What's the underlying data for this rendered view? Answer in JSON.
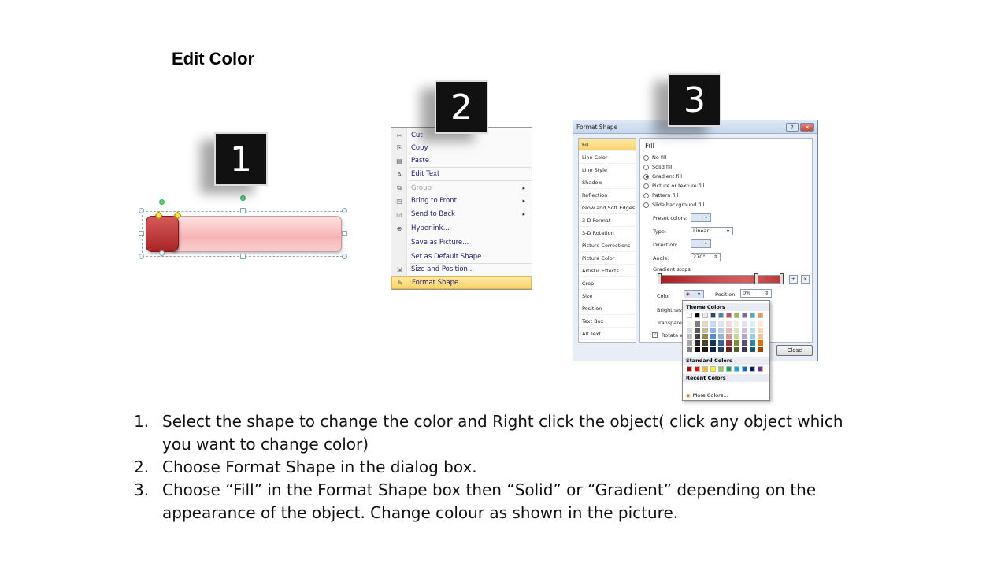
{
  "slide": {
    "title": "Edit Color"
  },
  "steps": [
    "1",
    "2",
    "3"
  ],
  "context_menu": {
    "items": [
      {
        "label": "Cut",
        "icon": "scissors-icon",
        "glyph": "✂",
        "submenu": false,
        "disabled": false,
        "highlight": false
      },
      {
        "label": "Copy",
        "icon": "copy-icon",
        "glyph": "⎘",
        "submenu": false,
        "disabled": false,
        "highlight": false
      },
      {
        "label": "Paste",
        "icon": "paste-icon",
        "glyph": "▤",
        "submenu": false,
        "disabled": false,
        "highlight": false
      },
      {
        "label": "Edit Text",
        "icon": "edit-text-icon",
        "glyph": "A",
        "submenu": false,
        "disabled": false,
        "highlight": false
      },
      {
        "label": "Group",
        "icon": "group-icon",
        "glyph": "⧉",
        "submenu": true,
        "disabled": true,
        "highlight": false
      },
      {
        "label": "Bring to Front",
        "icon": "bring-to-front-icon",
        "glyph": "◳",
        "submenu": true,
        "disabled": false,
        "highlight": false
      },
      {
        "label": "Send to Back",
        "icon": "send-to-back-icon",
        "glyph": "◲",
        "submenu": true,
        "disabled": false,
        "highlight": false
      },
      {
        "label": "Hyperlink...",
        "icon": "hyperlink-icon",
        "glyph": "⊕",
        "submenu": false,
        "disabled": false,
        "highlight": false
      },
      {
        "label": "Save as Picture...",
        "icon": "",
        "glyph": "",
        "submenu": false,
        "disabled": false,
        "highlight": false
      },
      {
        "label": "Set as Default Shape",
        "icon": "",
        "glyph": "",
        "submenu": false,
        "disabled": false,
        "highlight": false
      },
      {
        "label": "Size and Position...",
        "icon": "size-position-icon",
        "glyph": "⇲",
        "submenu": false,
        "disabled": false,
        "highlight": false
      },
      {
        "label": "Format Shape...",
        "icon": "format-shape-icon",
        "glyph": "✎",
        "submenu": false,
        "disabled": false,
        "highlight": true
      }
    ]
  },
  "dialog": {
    "title": "Format Shape",
    "help": "?",
    "close_x": "✕",
    "sidebar": [
      "Fill",
      "Line Color",
      "Line Style",
      "Shadow",
      "Reflection",
      "Glow and Soft Edges",
      "3-D Format",
      "3-D Rotation",
      "Picture Corrections",
      "Picture Color",
      "Artistic Effects",
      "Crop",
      "Size",
      "Position",
      "Text Box",
      "Alt Text"
    ],
    "fill_heading": "Fill",
    "fill_options": [
      {
        "label": "No fill",
        "checked": false
      },
      {
        "label": "Solid fill",
        "checked": false
      },
      {
        "label": "Gradient fill",
        "checked": true
      },
      {
        "label": "Picture or texture fill",
        "checked": false
      },
      {
        "label": "Pattern fill",
        "checked": false
      },
      {
        "label": "Slide background fill",
        "checked": false
      }
    ],
    "preset_colors_label": "Preset colors:",
    "type_label": "Type:",
    "type_value": "Linear",
    "direction_label": "Direction:",
    "angle_label": "Angle:",
    "angle_value": "270°",
    "gradient_stops_label": "Gradient stops",
    "color_label": "Color",
    "position_label": "Position:",
    "position_value": "0%",
    "brightness_label": "Brightness",
    "transparency_label": "Transparen",
    "rotate_label": "Rotate w",
    "rotate_checked": "✓",
    "close_button": "Close"
  },
  "color_popup": {
    "theme_heading": "Theme Colors",
    "standard_heading": "Standard Colors",
    "recent_heading": "Recent Colors",
    "more_colors": "More Colors...",
    "theme_top": [
      "#ffffff",
      "#000000",
      "#eeece1",
      "#1f497d",
      "#4f81bd",
      "#c0504d",
      "#9bbb59",
      "#8064a2",
      "#4bacc6",
      "#f79646"
    ],
    "theme_shades": [
      [
        "#f2f2f2",
        "#7f7f7f",
        "#ddd9c3",
        "#c6d9f0",
        "#dbe5f1",
        "#f2dcdb",
        "#ebf1dd",
        "#e5e0ec",
        "#dbeef3",
        "#fdeada"
      ],
      [
        "#d8d8d8",
        "#595959",
        "#c4bd97",
        "#8db3e2",
        "#b8cce4",
        "#e5b9b7",
        "#d7e3bc",
        "#ccc1d9",
        "#b7dde8",
        "#fbd5b5"
      ],
      [
        "#bfbfbf",
        "#3f3f3f",
        "#938953",
        "#548dd4",
        "#95b3d7",
        "#d99694",
        "#c3d69b",
        "#b2a2c7",
        "#92cddc",
        "#fac08f"
      ],
      [
        "#a5a5a5",
        "#262626",
        "#494429",
        "#17365d",
        "#366092",
        "#953734",
        "#76923c",
        "#5f497a",
        "#31859b",
        "#e36c09"
      ],
      [
        "#7f7f7f",
        "#0c0c0c",
        "#1d1b10",
        "#0f243e",
        "#244061",
        "#632423",
        "#4f6128",
        "#3f3151",
        "#205867",
        "#974806"
      ]
    ],
    "standard": [
      "#c00000",
      "#ff0000",
      "#ffc000",
      "#ffff00",
      "#92d050",
      "#00b050",
      "#00b0f0",
      "#0070c0",
      "#002060",
      "#7030a0"
    ]
  },
  "instructions": [
    {
      "num": "1.",
      "text": "Select the shape to change the color and Right click the object( click any object which you want to change color)"
    },
    {
      "num": "2.",
      "text": "Choose Format Shape in the dialog box."
    },
    {
      "num": "3.",
      "text": "Choose “Fill” in the Format Shape box then “Solid” or “Gradient” depending on the appearance of the object. Change colour as shown in the picture."
    }
  ]
}
